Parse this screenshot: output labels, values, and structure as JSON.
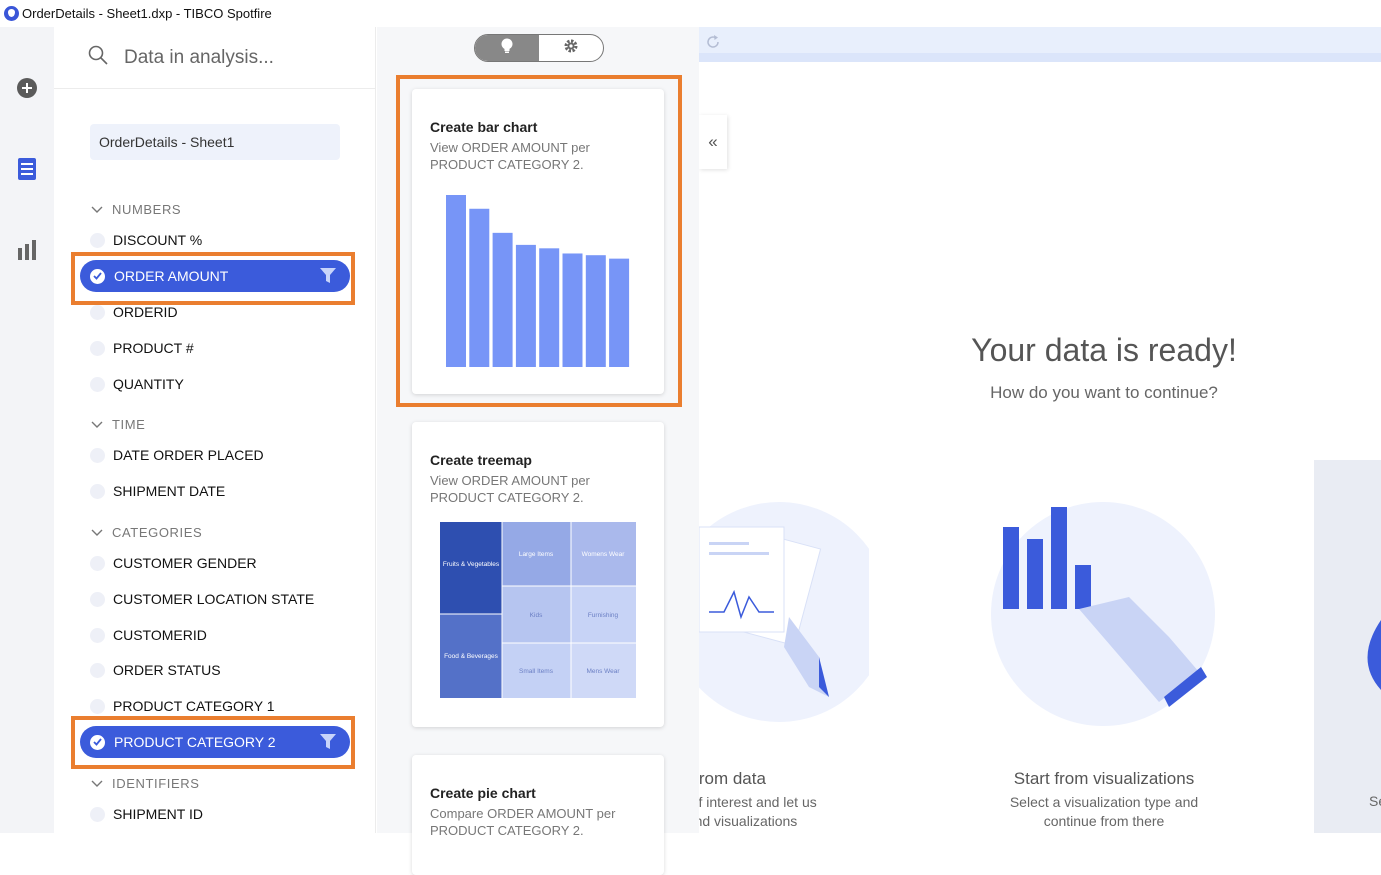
{
  "window": {
    "title": "OrderDetails - Sheet1.dxp - TIBCO Spotfire"
  },
  "data_panel": {
    "search_placeholder": "Data in analysis...",
    "source": "OrderDetails - Sheet1",
    "sections": {
      "numbers": "NUMBERS",
      "time": "TIME",
      "categories": "CATEGORIES",
      "identifiers": "IDENTIFIERS"
    },
    "fields": {
      "discount": "DISCOUNT %",
      "order_amount": "ORDER AMOUNT",
      "orderid": "ORDERID",
      "product_no": "PRODUCT #",
      "quantity": "QUANTITY",
      "date_order_placed": "DATE ORDER PLACED",
      "shipment_date": "SHIPMENT DATE",
      "customer_gender": "CUSTOMER GENDER",
      "customer_location_state": "CUSTOMER LOCATION STATE",
      "customerid": "CUSTOMERID",
      "order_status": "ORDER STATUS",
      "product_category_1": "PRODUCT CATEGORY 1",
      "product_category_2": "PRODUCT CATEGORY 2",
      "shipment_id": "SHIPMENT ID"
    },
    "selected": [
      "ORDER AMOUNT",
      "PRODUCT CATEGORY 2"
    ]
  },
  "recommendations": {
    "toggle": {
      "left_icon": "lightbulb-icon",
      "right_icon": "gear-icon",
      "active": "left"
    },
    "bar_card": {
      "title": "Create bar chart",
      "desc": "View ORDER AMOUNT per PRODUCT CATEGORY 2.",
      "bar_values": [
        100,
        92,
        78,
        71,
        69,
        66,
        65,
        63
      ]
    },
    "treemap_card": {
      "title": "Create treemap",
      "desc": "View ORDER AMOUNT per PRODUCT CATEGORY 2.",
      "tiles": {
        "fruits_veg": "Fruits & Vegetables",
        "food_bev": "Food & Beverages",
        "large_items": "Large Items",
        "kids": "Kids",
        "small_items": "Small Items",
        "womens_wear": "Womens Wear",
        "furnishing": "Furnishing",
        "mens_wear": "Mens Wear"
      }
    },
    "pie_card": {
      "title": "Create pie chart",
      "desc": "Compare ORDER AMOUNT per PRODUCT CATEGORY 2."
    }
  },
  "main": {
    "collapse_glyph": "«",
    "headline": "Your data is ready!",
    "subhead": "How do you want to continue?",
    "option_data": {
      "title": "rt from data",
      "desc_line1": "a of interest and let us",
      "desc_line2": "nend visualizations"
    },
    "option_viz": {
      "title": "Start from visualizations",
      "desc_line1": "Select a visualization type and",
      "desc_line2": "continue from there"
    },
    "option_third_fragment": "Se"
  },
  "colors": {
    "accent": "#3b5bdb",
    "highlight": "#ea7e2f",
    "bar": "#7795f7"
  }
}
